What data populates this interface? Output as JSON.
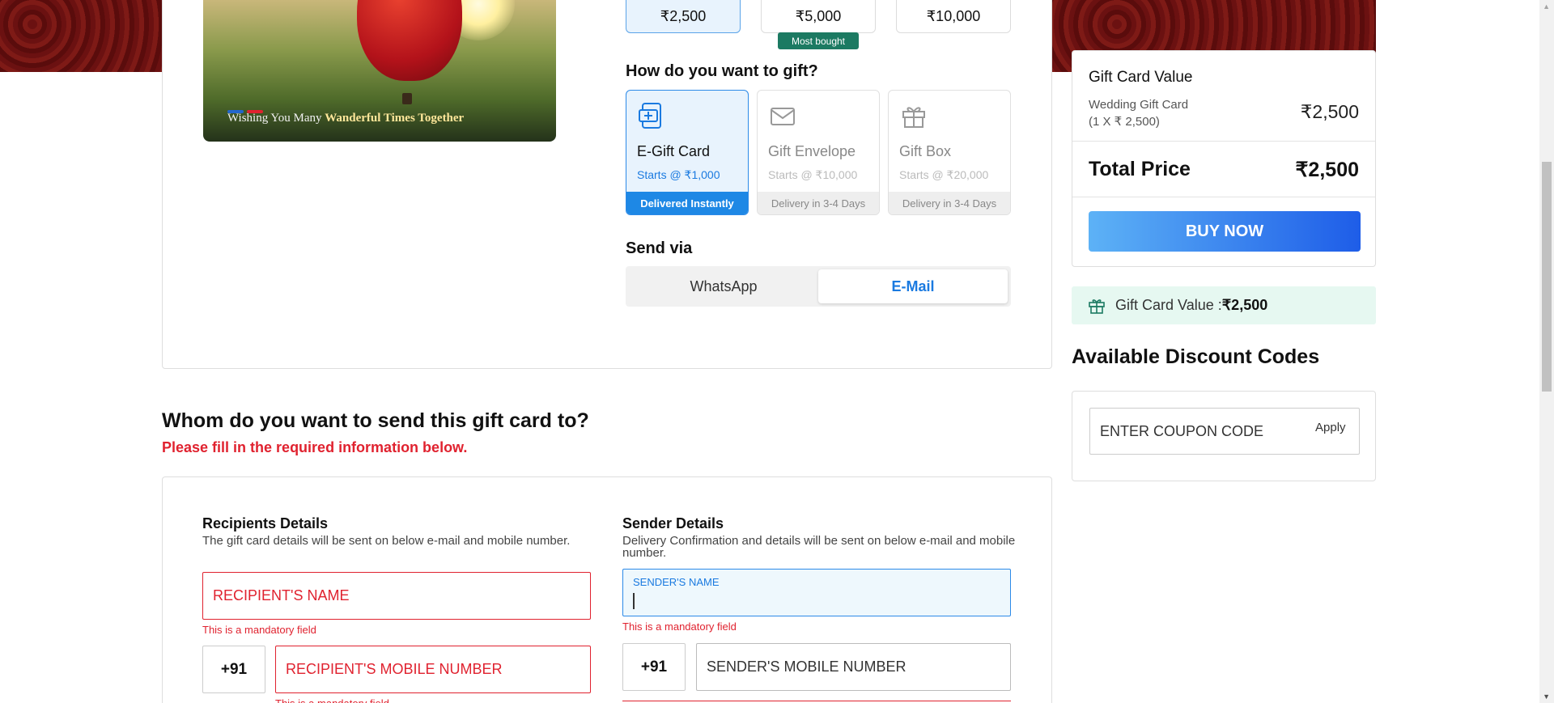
{
  "hero": {
    "caption_plain": "Wishing You Many ",
    "caption_bold": "Wanderful Times Together",
    "dot_colors": [
      "#2266cc",
      "#e0222f"
    ]
  },
  "denominations": [
    {
      "label": "₹2,500",
      "selected": true
    },
    {
      "label": "₹5,000",
      "selected": false
    },
    {
      "label": "₹10,000",
      "selected": false
    }
  ],
  "most_bought_label": "Most bought",
  "gift_question": "How do you want to gift?",
  "gift_options": [
    {
      "name": "E-Gift Card",
      "price": "Starts @ ₹1,000",
      "delivery": "Delivered Instantly",
      "icon": "egift-card-icon",
      "selected": true
    },
    {
      "name": "Gift Envelope",
      "price": "Starts @ ₹10,000",
      "delivery": "Delivery in 3-4 Days",
      "icon": "envelope-icon",
      "selected": false
    },
    {
      "name": "Gift Box",
      "price": "Starts @ ₹20,000",
      "delivery": "Delivery in 3-4 Days",
      "icon": "gift-box-icon",
      "selected": false
    }
  ],
  "send_via": {
    "title": "Send via",
    "options": [
      {
        "label": "WhatsApp",
        "selected": false
      },
      {
        "label": "E-Mail",
        "selected": true
      }
    ]
  },
  "summary": {
    "title": "Gift Card Value",
    "item_name": "Wedding Gift Card",
    "item_qty": "(1 X ₹ 2,500)",
    "item_amount": "₹2,500",
    "total_label": "Total Price",
    "total_amount": "₹2,500",
    "buy_label": "BUY NOW"
  },
  "gift_value_strip": {
    "label": "Gift Card Value : ",
    "value": "₹2,500",
    "icon": "gift-icon"
  },
  "discount": {
    "title": "Available Discount Codes",
    "coupon_placeholder": "ENTER COUPON CODE",
    "apply_label": "Apply"
  },
  "recipient_section": {
    "title": "Whom do you want to send this gift card to?",
    "fill_message": "Please fill in the required information below."
  },
  "recipients": {
    "title": "Recipients Details",
    "desc": "The gift card details will be sent on below e-mail and mobile number.",
    "name_placeholder": "RECIPIENT'S NAME",
    "country_code": "+91",
    "mobile_placeholder": "RECIPIENT'S MOBILE NUMBER",
    "error_msg": "This is a mandatory field"
  },
  "sender": {
    "title": "Sender Details",
    "desc_line1": "Delivery Confirmation and details will be sent on below e-mail and mobile",
    "desc_line2": "number.",
    "name_label": "SENDER'S NAME",
    "country_code": "+91",
    "mobile_placeholder": "SENDER'S MOBILE NUMBER",
    "error_msg": "This is a mandatory field"
  },
  "colors": {
    "accent_blue": "#1a7ae0",
    "error_red": "#e0222f",
    "banner_maroon": "#6b1111",
    "badge_green": "#1c7a62"
  }
}
